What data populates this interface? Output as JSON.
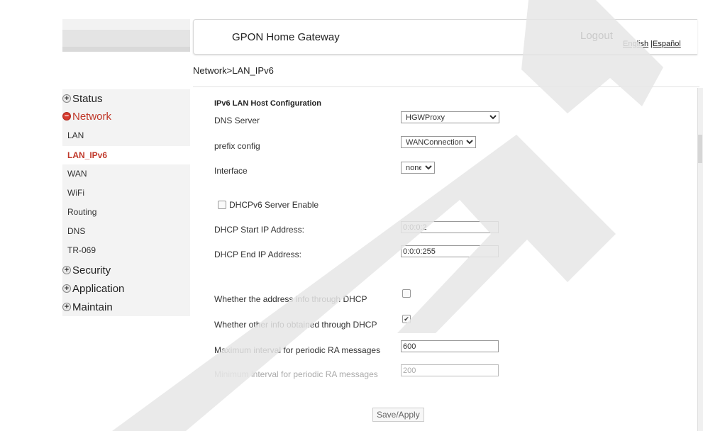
{
  "header": {
    "title": "GPON Home Gateway",
    "logout": "Logout",
    "lang_english": "English",
    "lang_sep": " |",
    "lang_spanish": "Español"
  },
  "breadcrumb": "Network>LAN_IPv6",
  "sidebar": {
    "groups": [
      {
        "label": "Status",
        "icon": "plus-circle-icon"
      },
      {
        "label": "Network",
        "icon": "minus-circle-icon"
      },
      {
        "label": "Security",
        "icon": "plus-circle-icon"
      },
      {
        "label": "Application",
        "icon": "plus-circle-icon"
      },
      {
        "label": "Maintain",
        "icon": "plus-circle-icon"
      }
    ],
    "network_items": [
      "LAN",
      "LAN_IPv6",
      "WAN",
      "WiFi",
      "Routing",
      "DNS",
      "TR-069"
    ],
    "selected": "LAN_IPv6"
  },
  "form": {
    "section_title": "IPv6 LAN Host Configuration",
    "dns_server": {
      "label": "DNS Server",
      "value": "HGWProxy"
    },
    "prefix_config": {
      "label": "prefix config",
      "value": "WANConnection"
    },
    "interface": {
      "label": "Interface",
      "value": "none"
    },
    "dhcpv6_enable": {
      "label": "DHCPv6 Server Enable",
      "checked": false
    },
    "dhcp_start": {
      "label": "DHCP Start IP Address:",
      "value": "0:0:0:2"
    },
    "dhcp_end": {
      "label": "DHCP End IP Address:",
      "value": "0:0:0:255"
    },
    "addr_via_dhcp": {
      "label": "Whether the address info through DHCP",
      "checked": false
    },
    "other_via_dhcp": {
      "label": "Whether other info obtained through DHCP",
      "checked": true
    },
    "max_ra": {
      "label": "Maximum interval for periodic RA messages",
      "value": "600"
    },
    "min_ra": {
      "label": "Minimum interval for periodic RA messages",
      "value": "200"
    },
    "save_button": "Save/Apply"
  },
  "colors": {
    "active": "#c0392b",
    "watermark": "#e6e6e6"
  }
}
